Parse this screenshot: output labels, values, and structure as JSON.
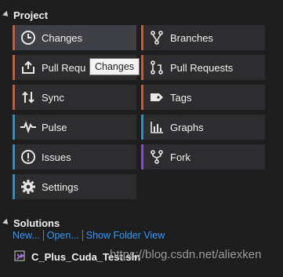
{
  "project": {
    "header": "Project",
    "tiles": [
      {
        "label": "Changes",
        "icon": "clock-icon"
      },
      {
        "label": "Branches",
        "icon": "branch-icon"
      },
      {
        "label": "Pull Requ",
        "icon": "upload-tray-icon"
      },
      {
        "label": "Pull Requests",
        "icon": "pull-request-icon"
      },
      {
        "label": "Sync",
        "icon": "sync-arrows-icon"
      },
      {
        "label": "Tags",
        "icon": "tag-icon"
      },
      {
        "label": "Pulse",
        "icon": "pulse-icon"
      },
      {
        "label": "Graphs",
        "icon": "bar-graph-icon"
      },
      {
        "label": "Issues",
        "icon": "alert-circle-icon"
      },
      {
        "label": "Fork",
        "icon": "fork-icon"
      },
      {
        "label": "Settings",
        "icon": "gear-icon"
      }
    ],
    "tooltip": "Changes"
  },
  "solutions": {
    "header": "Solutions",
    "links": [
      "New...",
      "Open...",
      "Show Folder View"
    ],
    "solution_name": "C_Plus_Cuda_Test.sln"
  },
  "watermark": "https://blog.csdn.net/aliexken",
  "colors": {
    "orange_accent": "#c75b3a",
    "blue_accent": "#2f8fbe",
    "purple_accent": "#8a4bc8",
    "link": "#3399ff"
  }
}
